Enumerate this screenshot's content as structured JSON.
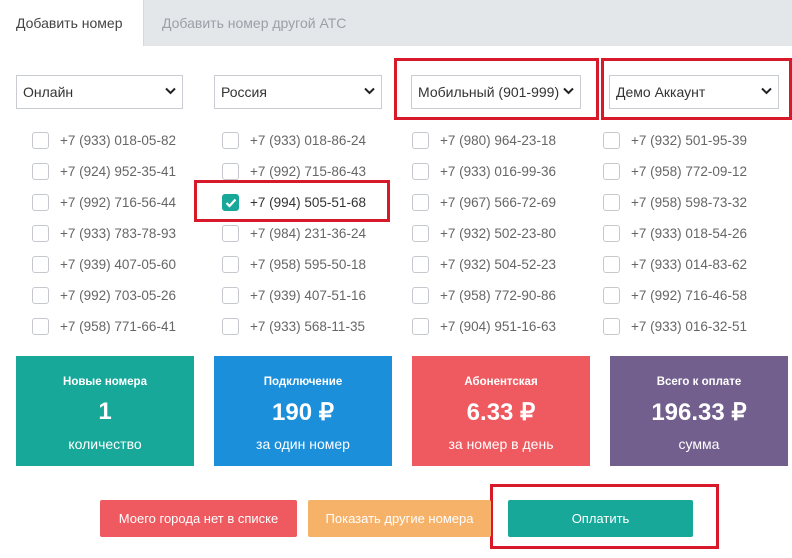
{
  "tabs": {
    "add_number": "Добавить номер",
    "add_other_ats": "Добавить номер другой АТС"
  },
  "filters": {
    "type": "Онлайн",
    "country": "Россия",
    "range": "Мобильный (901-999)",
    "account": "Демо Аккаунт"
  },
  "numbers": {
    "col1": [
      {
        "number": "+7 (933) 018-05-82",
        "checked": false
      },
      {
        "number": "+7 (924) 952-35-41",
        "checked": false
      },
      {
        "number": "+7 (992) 716-56-44",
        "checked": false
      },
      {
        "number": "+7 (933) 783-78-93",
        "checked": false
      },
      {
        "number": "+7 (939) 407-05-60",
        "checked": false
      },
      {
        "number": "+7 (992) 703-05-26",
        "checked": false
      },
      {
        "number": "+7 (958) 771-66-41",
        "checked": false
      }
    ],
    "col2": [
      {
        "number": "+7 (933) 018-86-24",
        "checked": false
      },
      {
        "number": "+7 (992) 715-86-43",
        "checked": false
      },
      {
        "number": "+7 (994) 505-51-68",
        "checked": true
      },
      {
        "number": "+7 (984) 231-36-24",
        "checked": false
      },
      {
        "number": "+7 (958) 595-50-18",
        "checked": false
      },
      {
        "number": "+7 (939) 407-51-16",
        "checked": false
      },
      {
        "number": "+7 (933) 568-11-35",
        "checked": false
      }
    ],
    "col3": [
      {
        "number": "+7 (980) 964-23-18",
        "checked": false
      },
      {
        "number": "+7 (933) 016-99-36",
        "checked": false
      },
      {
        "number": "+7 (967) 566-72-69",
        "checked": false
      },
      {
        "number": "+7 (932) 502-23-80",
        "checked": false
      },
      {
        "number": "+7 (932) 504-52-23",
        "checked": false
      },
      {
        "number": "+7 (958) 772-90-86",
        "checked": false
      },
      {
        "number": "+7 (904) 951-16-63",
        "checked": false
      }
    ],
    "col4": [
      {
        "number": "+7 (932) 501-95-39",
        "checked": false
      },
      {
        "number": "+7 (958) 772-09-12",
        "checked": false
      },
      {
        "number": "+7 (958) 598-73-32",
        "checked": false
      },
      {
        "number": "+7 (933) 018-54-26",
        "checked": false
      },
      {
        "number": "+7 (933) 014-83-62",
        "checked": false
      },
      {
        "number": "+7 (992) 716-46-58",
        "checked": false
      },
      {
        "number": "+7 (933) 016-32-51",
        "checked": false
      }
    ]
  },
  "summary": {
    "new_numbers": {
      "title": "Новые номера",
      "value": "1",
      "sub": "количество",
      "color": "#17a89a"
    },
    "connection": {
      "title": "Подключение",
      "value": "190 ₽",
      "sub": "за один номер",
      "color": "#1c8fdb"
    },
    "subscription": {
      "title": "Абонентская",
      "value": "6.33 ₽",
      "sub": "за номер в день",
      "color": "#ee5a5f"
    },
    "total": {
      "title": "Всего к оплате",
      "value": "196.33 ₽",
      "sub": "сумма",
      "color": "#725f8d"
    }
  },
  "actions": {
    "no_city": "Моего города нет в списке",
    "show_other": "Показать другие номера",
    "pay": "Оплатить"
  },
  "colors": {
    "highlight": "#d7192a",
    "no_city_btn": "#ee5a5f",
    "show_other_btn": "#f7b26a",
    "pay_btn": "#17a89a"
  }
}
